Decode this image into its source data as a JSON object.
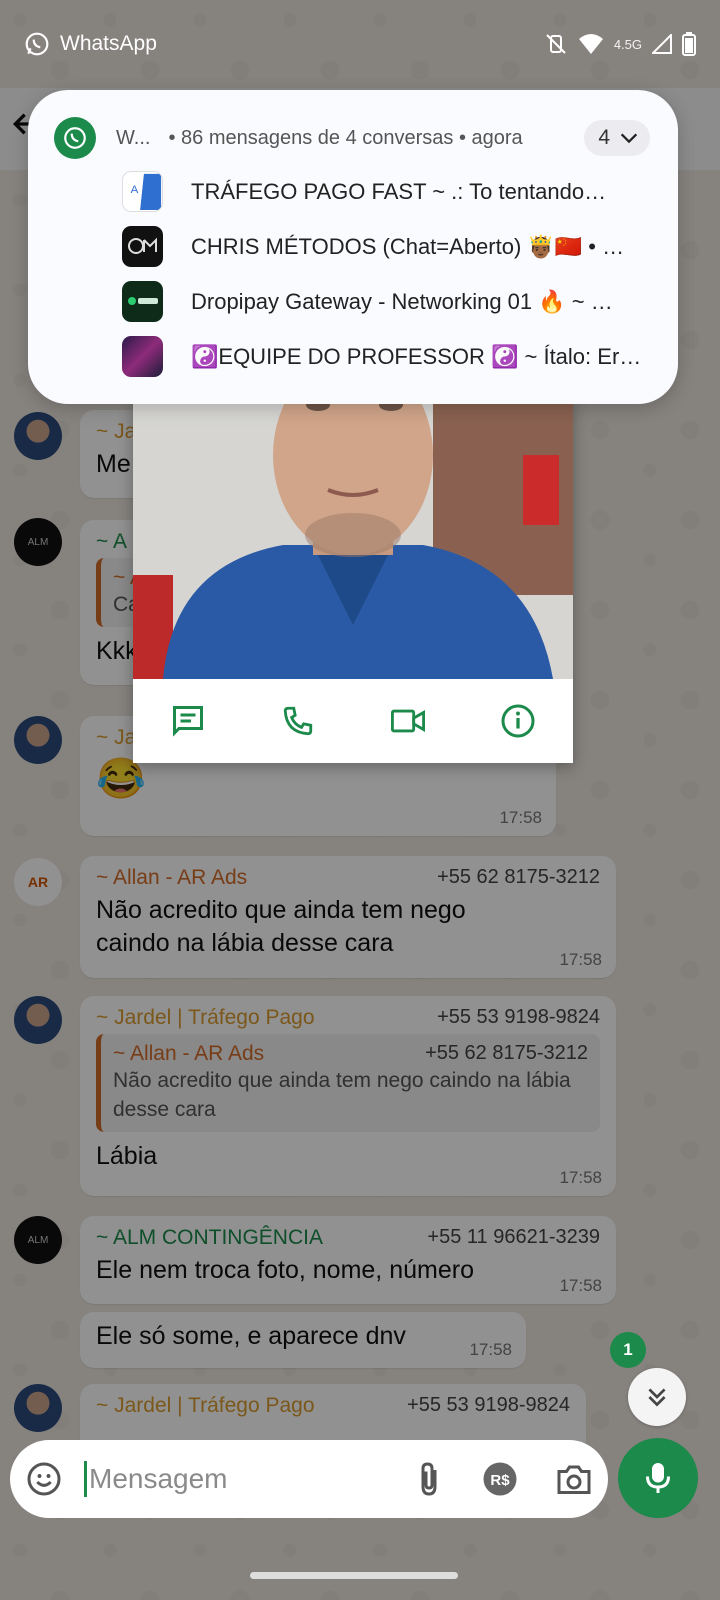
{
  "status_bar": {
    "app_label": "WhatsApp",
    "network": "4.5G"
  },
  "notification": {
    "app_name": "W...",
    "summary": "• 86 mensagens de 4 conversas • agora",
    "count": "4",
    "rows": [
      {
        "label": "TRÁFEGO PAGO FAST  ~ .: To tentando…"
      },
      {
        "label": "CHRIS MÉTODOS (Chat=Aberto) 🤴🏾🇨🇳 • …"
      },
      {
        "label": "Dropipay Gateway - Networking 01 🔥  ~ …"
      },
      {
        "label": "☯️EQUIPE DO PROFESSOR ☯️  ~ Ítalo: Er…"
      }
    ]
  },
  "messages": [
    {
      "sender": "~ Ja",
      "text": "Me"
    },
    {
      "sender": "~ A",
      "quote_sender": "~ A",
      "quote_text": "Ca",
      "text": "Kkk"
    },
    {
      "sender": "~ Ja",
      "text": "😂",
      "time": "17:58"
    },
    {
      "sender": "~ Allan - AR Ads",
      "phone": "+55 62 8175-3212",
      "text": "Não acredito que ainda tem nego caindo na lábia desse cara",
      "time": "17:58"
    },
    {
      "sender": "~ Jardel | Tráfego Pago",
      "phone": "+55 53 9198-9824",
      "quote_sender": "~ Allan - AR Ads",
      "quote_phone": "+55 62 8175-3212",
      "quote_text": "Não acredito que ainda tem nego caindo na lábia desse cara",
      "text": "Lábia",
      "time": "17:58"
    },
    {
      "sender": "~ ALM CONTINGÊNCIA",
      "phone": "+55 11 96621-3239",
      "text": "Ele nem troca foto, nome, número",
      "time": "17:58"
    },
    {
      "text": "Ele só some, e aparece dnv",
      "time": "17:58"
    },
    {
      "sender": "~ Jardel | Tráfego Pago",
      "phone": "+55 53 9198-9824"
    }
  ],
  "avatars": {
    "alm": "ALM",
    "ar": "AR"
  },
  "unread_count": "1",
  "input": {
    "placeholder": "Mensagem"
  },
  "colors": {
    "accent": "#1b8a4a",
    "sender_orange": "#d26b2a",
    "sender_gold": "#d89b2f"
  }
}
